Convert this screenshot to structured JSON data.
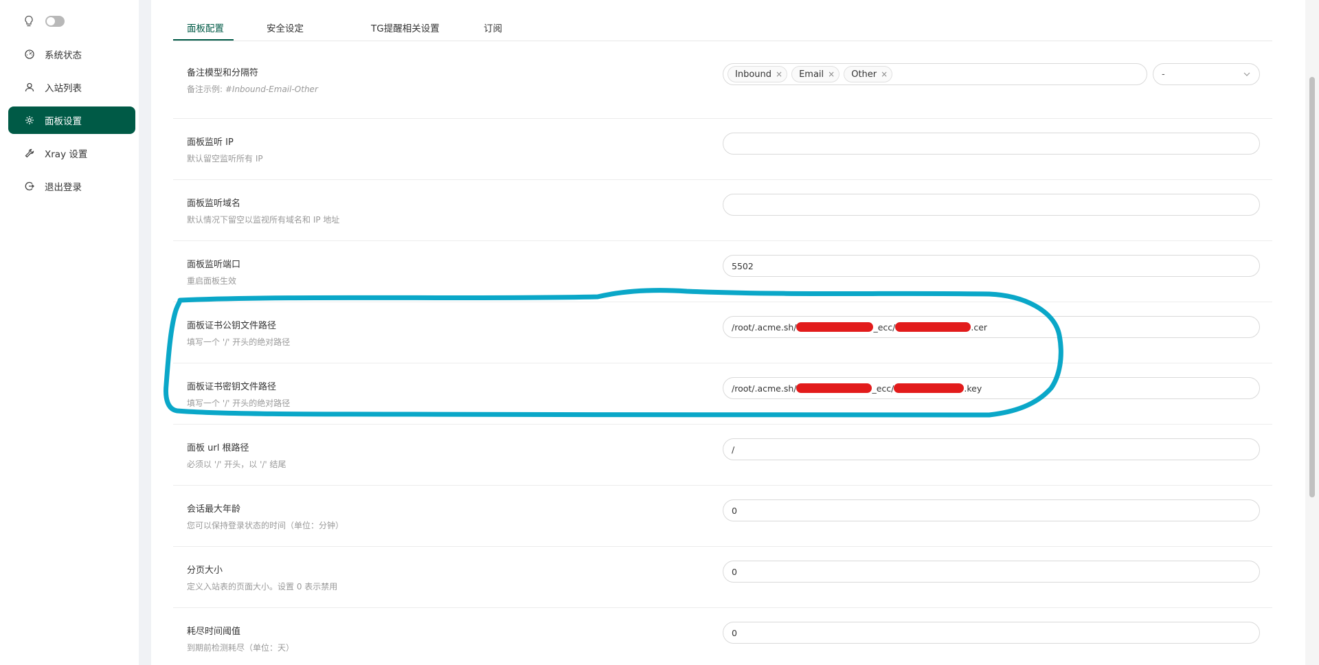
{
  "sidebar": {
    "items": [
      {
        "label": "系统状态",
        "icon": "dashboard-icon",
        "active": false
      },
      {
        "label": "入站列表",
        "icon": "user-icon",
        "active": false
      },
      {
        "label": "面板设置",
        "icon": "gear-icon",
        "active": true
      },
      {
        "label": "Xray 设置",
        "icon": "tool-icon",
        "active": false
      },
      {
        "label": "退出登录",
        "icon": "logout-icon",
        "active": false
      }
    ]
  },
  "tabs": [
    "面板配置",
    "安全设定",
    "TG提醒相关设置",
    "订阅"
  ],
  "active_tab": "面板配置",
  "settings": {
    "remark": {
      "title": "备注模型和分隔符",
      "desc_prefix": "备注示例: ",
      "desc_example": "#Inbound-Email-Other",
      "tags": [
        "Inbound",
        "Email",
        "Other"
      ],
      "separator": "-"
    },
    "listen_ip": {
      "title": "面板监听 IP",
      "desc": "默认留空监听所有 IP",
      "value": ""
    },
    "listen_domain": {
      "title": "面板监听域名",
      "desc": "默认情况下留空以监视所有域名和 IP 地址",
      "value": ""
    },
    "port": {
      "title": "面板监听端口",
      "desc": "重启面板生效",
      "value": "5502"
    },
    "cert_pub": {
      "title": "面板证书公钥文件路径",
      "desc": "填写一个 '/' 开头的绝对路径",
      "value_prefix": "/root/.acme.sh/",
      "value_mid": "_ecc/",
      "value_suffix": ".cer"
    },
    "cert_key": {
      "title": "面板证书密钥文件路径",
      "desc": "填写一个 '/' 开头的绝对路径",
      "value_prefix": "/root/.acme.sh/",
      "value_mid": "_ecc/",
      "value_suffix": ".key"
    },
    "url_base": {
      "title": "面板 url 根路径",
      "desc": "必须以 '/' 开头，以 '/' 结尾",
      "value": "/"
    },
    "session_age": {
      "title": "会话最大年龄",
      "desc": "您可以保持登录状态的时间（单位：分钟）",
      "value": "0"
    },
    "page_size": {
      "title": "分页大小",
      "desc": "定义入站表的页面大小。设置 0 表示禁用",
      "value": "0"
    },
    "expire_threshold": {
      "title": "耗尽时间阈值",
      "desc": "到期前检测耗尽（单位：天）",
      "value": "0"
    }
  },
  "colors": {
    "accent": "#005a46",
    "annotation": "#0aa7c8",
    "redaction": "#e21b1b"
  }
}
